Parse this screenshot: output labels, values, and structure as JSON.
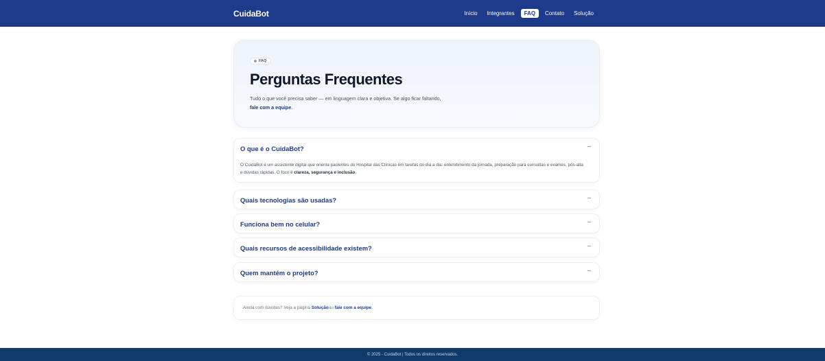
{
  "header": {
    "brand": "CuidaBot",
    "nav": [
      {
        "label": "Início"
      },
      {
        "label": "Integrantes"
      },
      {
        "label": "FAQ"
      },
      {
        "label": "Contato"
      },
      {
        "label": "Solução"
      }
    ],
    "active_nav": "FAQ",
    "color": "#1e3a8a"
  },
  "hero": {
    "badge": "FAQ",
    "title": "Perguntas Frequentes",
    "lead": "Tudo o que você precisa saber — em linguagem clara e objetiva. Se algo ficar faltando,",
    "lead_link": "fale com a equipe",
    "lead_end": "."
  },
  "faq": [
    {
      "question": "O que é o CuidaBot?",
      "expanded": true,
      "answer": "O CuidaBot é um assistente digital que orienta pacientes do Hospital das Clínicas em tarefas do dia a dia: entendimento da jornada, preparação para consultas e exames, pós-alta e dúvidas rápidas. O foco é ",
      "answer_bold": "clareza, segurança e inclusão",
      "answer_end": "."
    },
    {
      "question": "Quais tecnologias são usadas?",
      "expanded": false
    },
    {
      "question": "Funciona bem no celular?",
      "expanded": false
    },
    {
      "question": "Quais recursos de acessibilidade existem?",
      "expanded": false
    },
    {
      "question": "Quem mantém o projeto?",
      "expanded": false
    }
  ],
  "note": {
    "text_start": "Ainda com dúvidas? Veja a página ",
    "link1": "Solução",
    "text_mid": " ou ",
    "link2": "fale com a equipe",
    "text_end": "."
  },
  "footer": {
    "text": "© 2025 - CuidaBot | Todos os direitos reservados."
  }
}
